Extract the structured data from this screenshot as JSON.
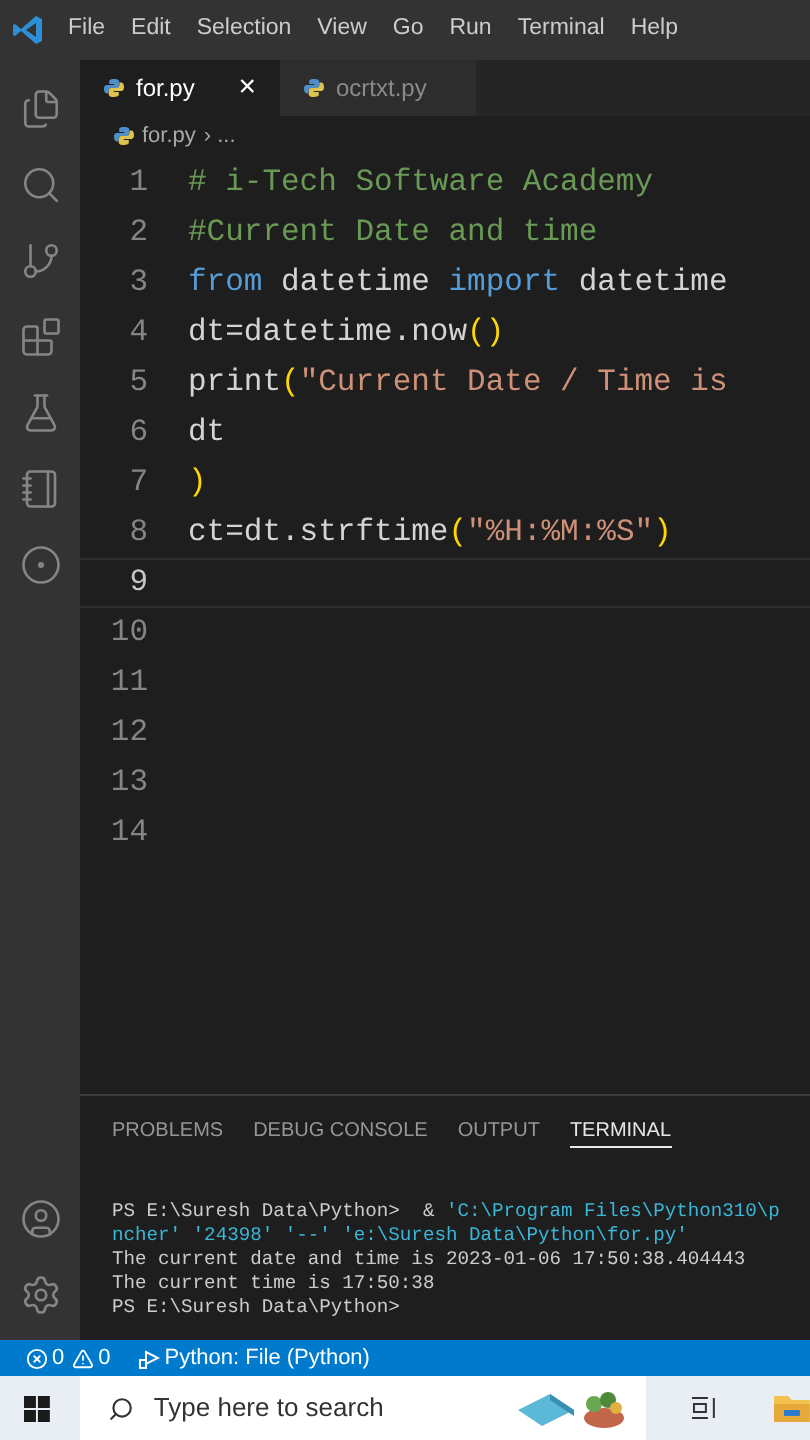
{
  "menu": [
    "File",
    "Edit",
    "Selection",
    "View",
    "Go",
    "Run",
    "Terminal",
    "Help"
  ],
  "tabs": [
    {
      "label": "for.py",
      "selected": true,
      "close": "×"
    },
    {
      "label": "ocrtxt.py",
      "selected": false
    }
  ],
  "breadcrumb": {
    "file": "for.py",
    "rest": "› ..."
  },
  "editor": {
    "lines": [
      {
        "number": "1",
        "current": false,
        "tokens": [
          {
            "text": "# i-Tech Software Academy",
            "kind": "comment"
          }
        ]
      },
      {
        "number": "2",
        "current": false,
        "tokens": [
          {
            "text": "#Current Date and time",
            "kind": "comment"
          }
        ]
      },
      {
        "number": "3",
        "current": false,
        "tokens": [
          {
            "text": "from",
            "kind": "keyword"
          },
          {
            "text": " datetime ",
            "kind": "plain"
          },
          {
            "text": "import",
            "kind": "keyword"
          },
          {
            "text": " datetime",
            "kind": "plain"
          }
        ]
      },
      {
        "number": "4",
        "current": false,
        "tokens": [
          {
            "text": "dt=datetime.now",
            "kind": "plain"
          },
          {
            "text": "()",
            "kind": "paren"
          }
        ]
      },
      {
        "number": "5",
        "current": false,
        "tokens": [
          {
            "text": "print",
            "kind": "plain"
          },
          {
            "text": "(",
            "kind": "paren"
          },
          {
            "text": "\"Current Date / Time is",
            "kind": "string"
          }
        ]
      },
      {
        "number": "6",
        "current": false,
        "tokens": [
          {
            "text": "dt",
            "kind": "plain"
          }
        ]
      },
      {
        "number": "7",
        "current": false,
        "tokens": [
          {
            "text": ")",
            "kind": "paren"
          }
        ]
      },
      {
        "number": "8",
        "current": false,
        "tokens": [
          {
            "text": "ct=dt.strftime",
            "kind": "plain"
          },
          {
            "text": "(",
            "kind": "paren"
          },
          {
            "text": "\"%H:%M:%S\"",
            "kind": "string"
          },
          {
            "text": ")",
            "kind": "paren"
          }
        ]
      },
      {
        "number": "9",
        "current": true
      },
      {
        "number": "10",
        "current": false
      },
      {
        "number": "11",
        "current": false
      },
      {
        "number": "12",
        "current": false
      },
      {
        "number": "13",
        "current": false
      },
      {
        "number": "14",
        "current": false
      }
    ]
  },
  "panel_tabs": [
    {
      "label": "PROBLEMS",
      "selected": false
    },
    {
      "label": "DEBUG CONSOLE",
      "selected": false
    },
    {
      "label": "OUTPUT",
      "selected": false
    },
    {
      "label": "TERMINAL",
      "selected": true
    }
  ],
  "terminal": [
    [
      {
        "text": "PS E:\\Suresh Data\\Python>  & ",
        "kind": "plain"
      },
      {
        "text": "'C:\\Program Files\\Python310\\p",
        "kind": "string"
      }
    ],
    [
      {
        "text": "ncher' '24398' '--' 'e:\\Suresh Data\\Python\\for.py'",
        "kind": "string"
      }
    ],
    [
      {
        "text": "The current date and time is 2023-01-06 17:50:38.404443",
        "kind": "plain"
      }
    ],
    [
      {
        "text": "The current time is 17:50:38",
        "kind": "plain"
      }
    ],
    [
      {
        "text": "PS E:\\Suresh Data\\Python>",
        "kind": "plain"
      }
    ]
  ],
  "status_bar": {
    "errors": "0",
    "warnings": "0",
    "run_config": "Python: File (Python)"
  },
  "taskbar": {
    "search": {
      "placeholder": "Type here to search"
    }
  }
}
